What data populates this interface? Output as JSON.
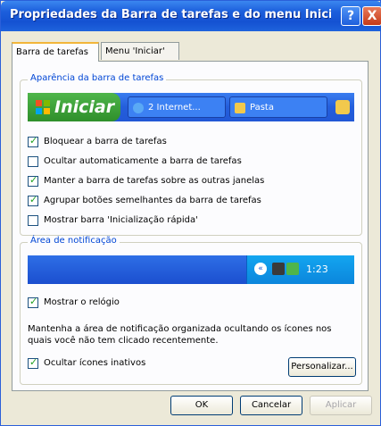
{
  "window": {
    "title": "Propriedades da Barra de tarefas e do menu Iniciar",
    "help_label": "?",
    "close_label": "X"
  },
  "tabs": [
    {
      "label": "Barra de tarefas",
      "active": true
    },
    {
      "label": "Menu 'Iniciar'",
      "active": false
    }
  ],
  "appearance": {
    "group_label": "Aparência da barra de tarefas",
    "preview": {
      "start_label": "Iniciar",
      "buttons": [
        "2 Internet...",
        "Pasta"
      ]
    },
    "options": [
      {
        "label": "Bloquear a barra de tarefas",
        "checked": true
      },
      {
        "label": "Ocultar automaticamente a barra de tarefas",
        "checked": false
      },
      {
        "label": "Manter a barra de tarefas sobre as outras janelas",
        "checked": true
      },
      {
        "label": "Agrupar botões semelhantes da barra de tarefas",
        "checked": true
      },
      {
        "label": "Mostrar barra 'Inicialização rápida'",
        "checked": false
      }
    ]
  },
  "notification": {
    "group_label": "Área de notificação",
    "clock_preview": "1:23",
    "show_clock": {
      "label": "Mostrar o relógio",
      "checked": true
    },
    "description": "Mantenha a área de notificação organizada ocultando os ícones nos quais você não tem clicado recentemente.",
    "hide_inactive": {
      "label": "Ocultar ícones inativos",
      "checked": true
    },
    "customize_label": "Personalizar..."
  },
  "footer": {
    "ok_label": "OK",
    "cancel_label": "Cancelar",
    "apply_label": "Aplicar",
    "apply_enabled": false
  },
  "colors": {
    "titlebar": "#1c5fdc",
    "group_label": "#0046d5",
    "start_button": "#2f8f2b",
    "checkmark": "#21a121"
  },
  "icons": [
    "windows-flag-icon",
    "internet-explorer-icon",
    "folder-icon",
    "show-hidden-icons-arrow",
    "tray-icon",
    "help-icon",
    "close-icon",
    "checkmark-icon"
  ]
}
